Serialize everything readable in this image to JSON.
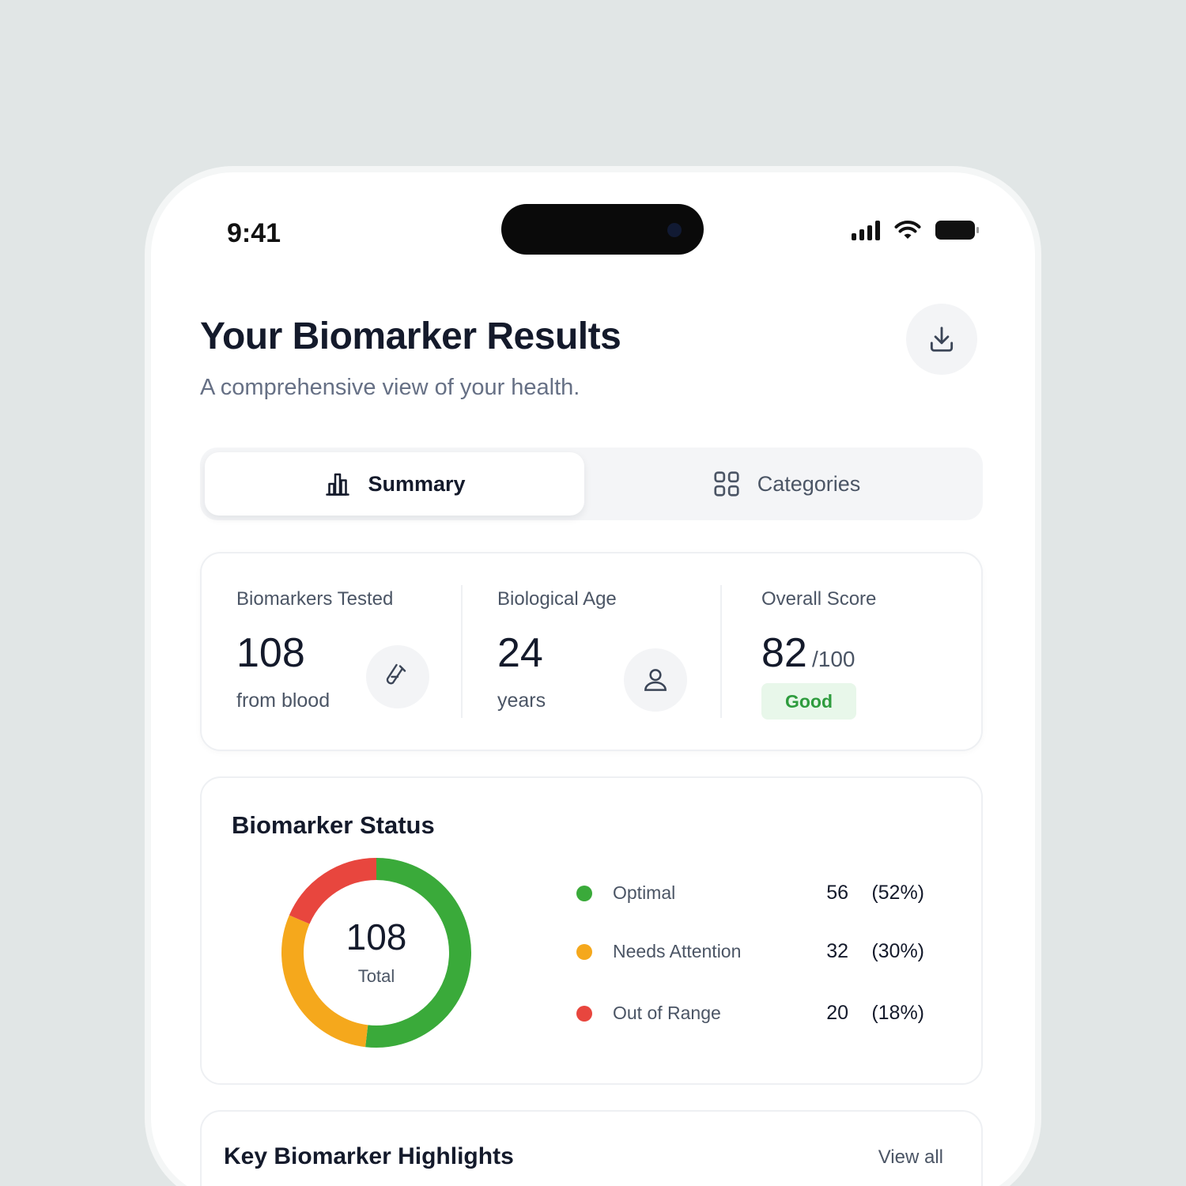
{
  "status_bar": {
    "time": "9:41",
    "icons": [
      "signal-icon",
      "wifi-icon",
      "battery-icon"
    ]
  },
  "header": {
    "title": "Your Biomarker Results",
    "subtitle": "A comprehensive view of your health.",
    "action_icon": "download-icon"
  },
  "tabs": [
    {
      "label": "Summary",
      "icon": "bar-chart-icon",
      "active": true
    },
    {
      "label": "Categories",
      "icon": "grid-icon",
      "active": false
    }
  ],
  "stats": {
    "tested": {
      "label": "Biomarkers Tested",
      "value": "108",
      "sub": "from blood",
      "icon": "test-tube-icon"
    },
    "age": {
      "label": "Biological Age",
      "value": "24",
      "sub": "years",
      "icon": "person-icon"
    },
    "score": {
      "label": "Overall Score",
      "value": "82",
      "unit": "/100",
      "badge": "Good"
    }
  },
  "status": {
    "title": "Biomarker Status",
    "total": "108",
    "total_label": "Total",
    "items": [
      {
        "name": "Optimal",
        "count": "56",
        "pct": "(52%)",
        "color": "#3aaa3a"
      },
      {
        "name": "Needs Attention",
        "count": "32",
        "pct": "(30%)",
        "color": "#f5a81c"
      },
      {
        "name": "Out of Range",
        "count": "20",
        "pct": "(18%)",
        "color": "#e8463e"
      }
    ]
  },
  "chart_data": {
    "type": "pie",
    "categories": [
      "Optimal",
      "Needs Attention",
      "Out of Range"
    ],
    "values": [
      56,
      32,
      20
    ],
    "colors": [
      "#3aaa3a",
      "#f5a81c",
      "#e8463e"
    ]
  },
  "highlights": {
    "title": "Key Biomarker Highlights",
    "view_all": "View all"
  }
}
